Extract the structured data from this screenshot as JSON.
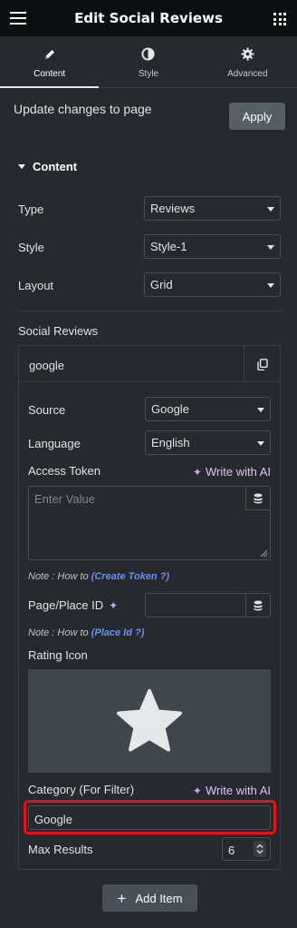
{
  "header": {
    "title": "Edit Social Reviews",
    "menu_icon": "hamburger-icon",
    "apps_icon": "grid-icon"
  },
  "tabs": [
    {
      "label": "Content",
      "icon": "pencil-icon",
      "active": true
    },
    {
      "label": "Style",
      "icon": "half-circle-icon",
      "active": false
    },
    {
      "label": "Advanced",
      "icon": "gear-icon",
      "active": false
    }
  ],
  "update": {
    "text": "Update changes to page",
    "button": "Apply"
  },
  "section": {
    "title": "Content"
  },
  "fields": {
    "type": {
      "label": "Type",
      "value": "Reviews"
    },
    "style": {
      "label": "Style",
      "value": "Style-1"
    },
    "layout": {
      "label": "Layout",
      "value": "Grid"
    }
  },
  "repeater": {
    "title": "Social Reviews",
    "item_label": "google",
    "source": {
      "label": "Source",
      "value": "Google"
    },
    "language": {
      "label": "Language",
      "value": "English"
    },
    "access_token": {
      "label": "Access Token",
      "ai": "Write with AI",
      "placeholder": "Enter Value"
    },
    "note1": {
      "prefix": "Note : How to ",
      "link": "(Create Token ?)"
    },
    "place_id": {
      "label": "Page/Place ID"
    },
    "note2": {
      "prefix": "Note : How to ",
      "link": "(Place Id ?)"
    },
    "rating_icon": {
      "label": "Rating Icon",
      "icon": "star-icon"
    },
    "category": {
      "label": "Category (For Filter)",
      "ai": "Write with AI",
      "value": "Google"
    },
    "max_results": {
      "label": "Max Results",
      "value": "6"
    }
  },
  "add_item": "Add Item",
  "colors": {
    "accent_highlight": "#e2121a",
    "link": "#6b8ff3",
    "ai": "#d9c7f2"
  }
}
